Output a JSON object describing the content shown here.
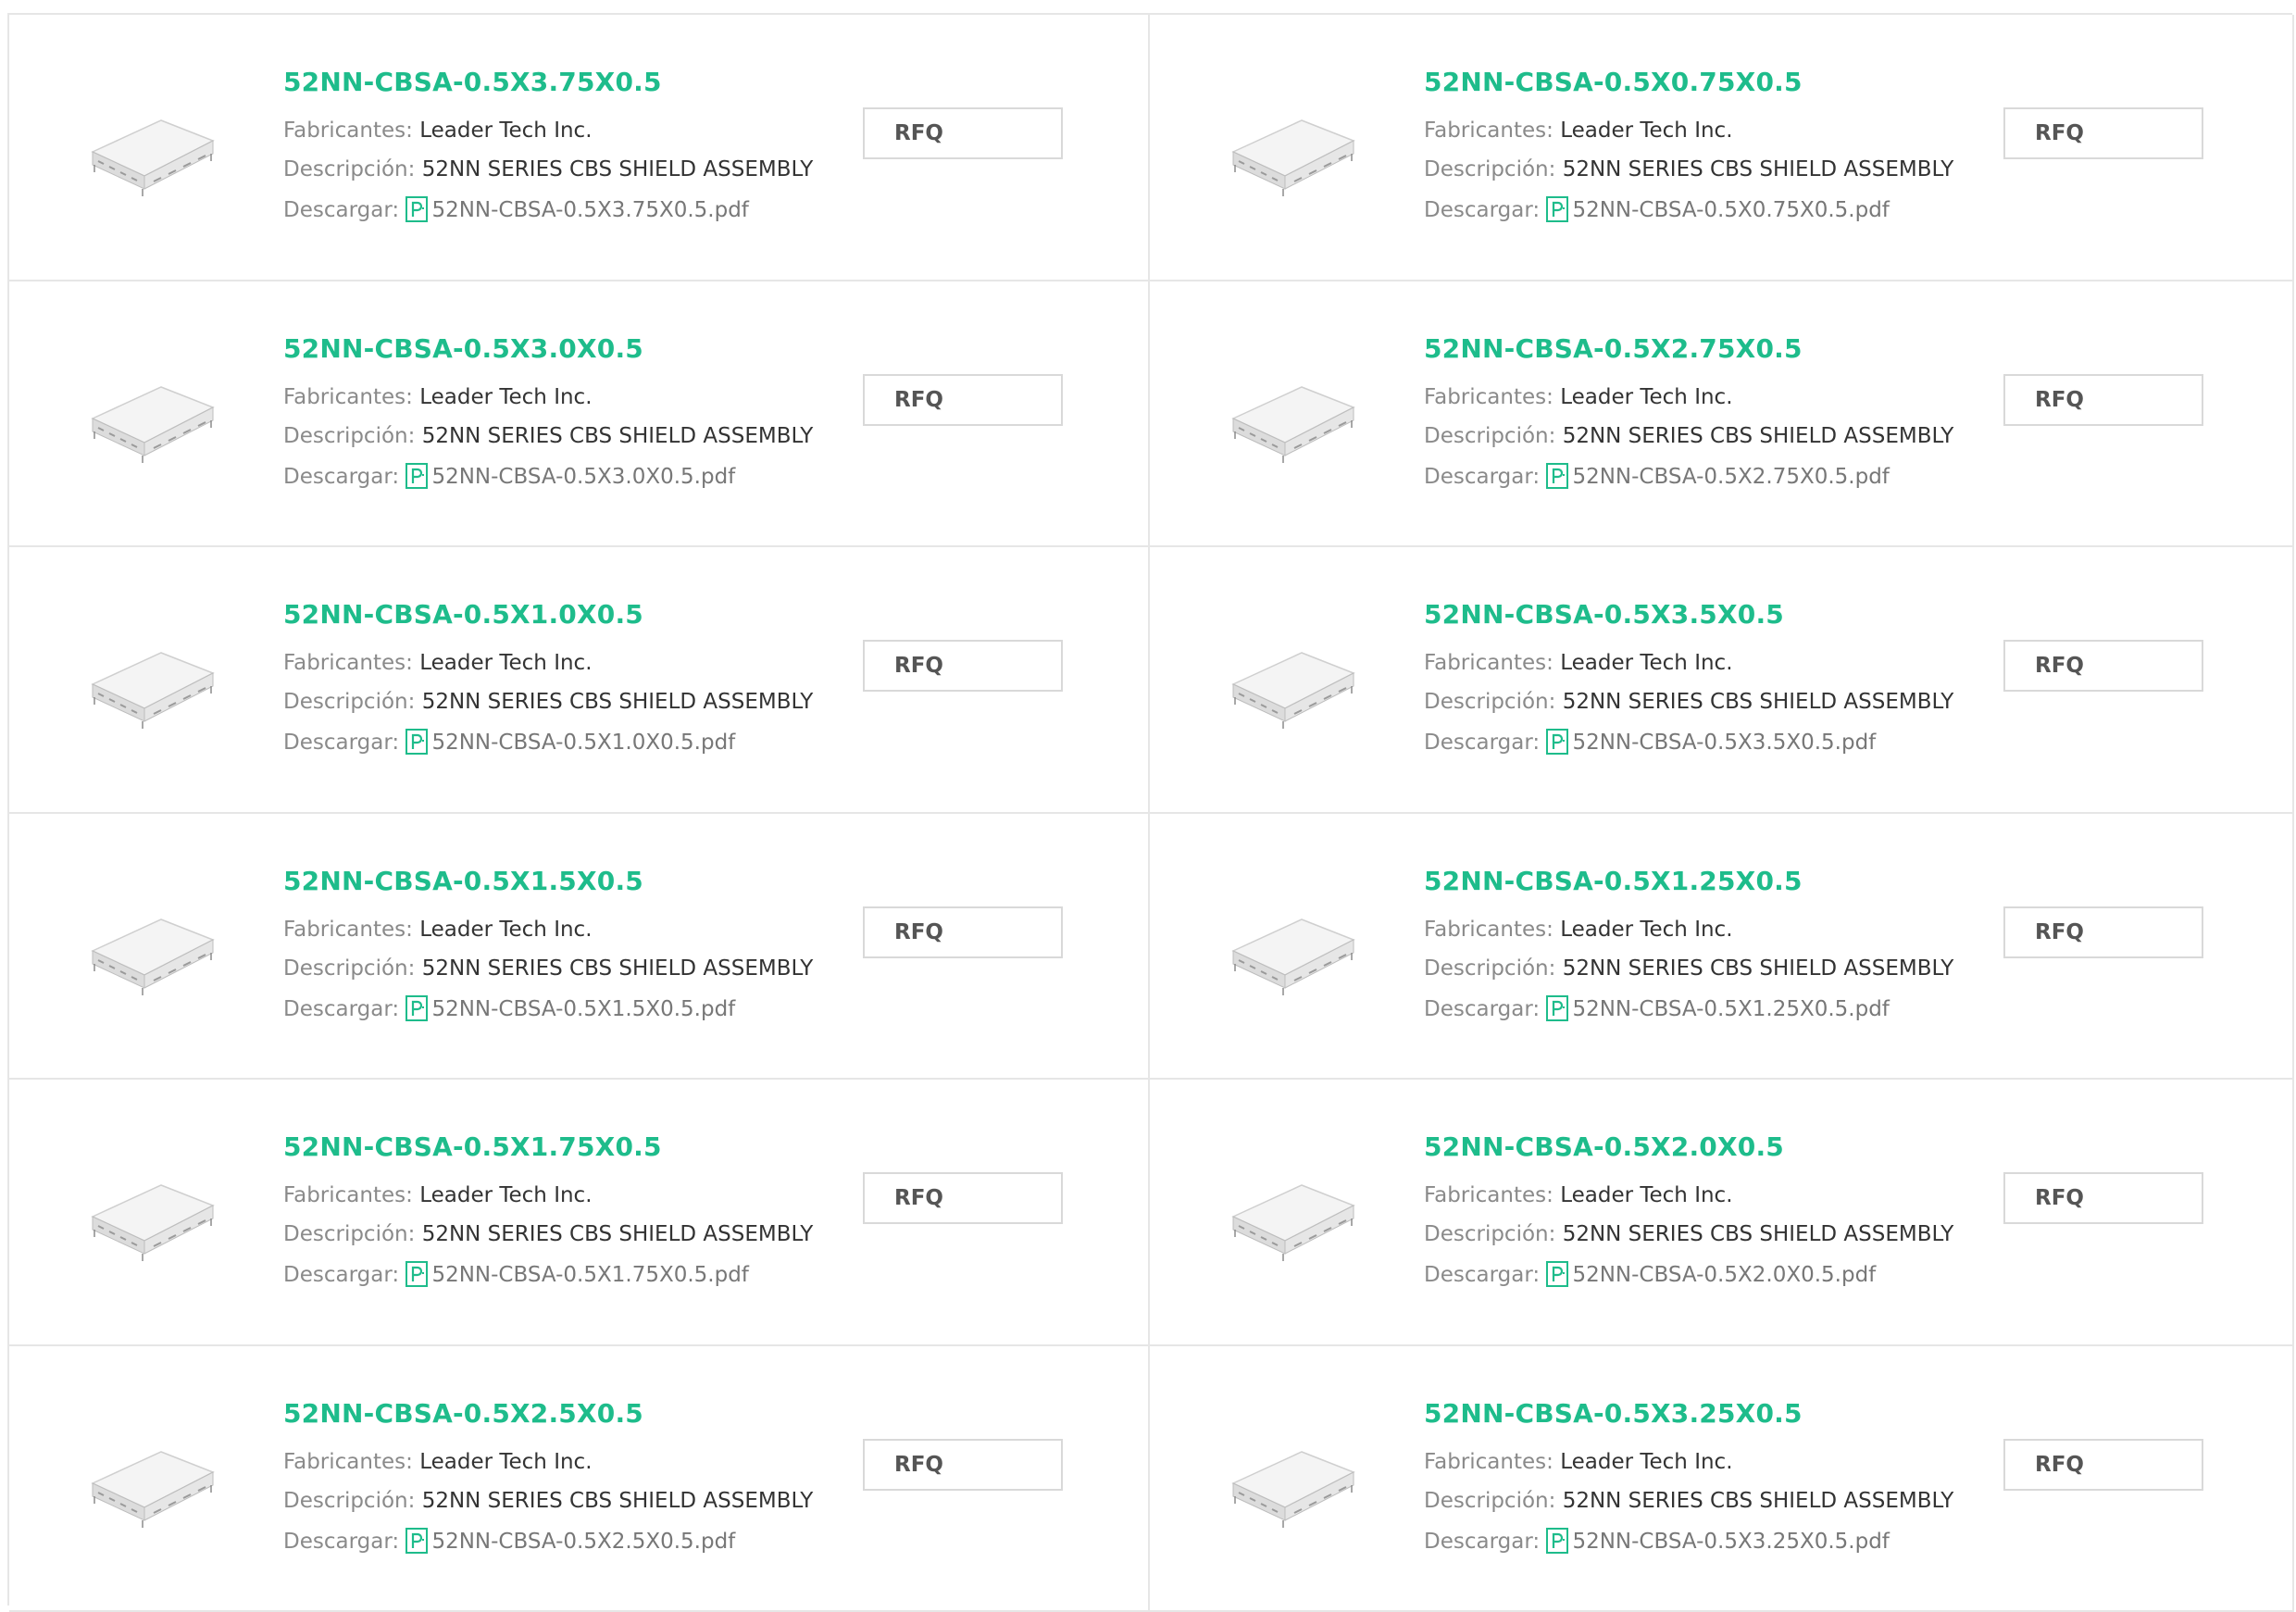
{
  "labels": {
    "manufacturer": "Fabricantes:",
    "description": "Descripción:",
    "download": "Descargar:",
    "rfq": "RFQ"
  },
  "colors": {
    "accent": "#1ebc8b",
    "border": "#e6e6e6"
  },
  "icons": {
    "pdf": "pdf-file-icon",
    "product": "product-thumbnail"
  },
  "products": [
    {
      "part": "52NN-CBSA-0.5X3.75X0.5",
      "manufacturer": "Leader Tech Inc.",
      "description": "52NN SERIES CBS SHIELD ASSEMBLY",
      "pdf": "52NN-CBSA-0.5X3.75X0.5.pdf"
    },
    {
      "part": "52NN-CBSA-0.5X0.75X0.5",
      "manufacturer": "Leader Tech Inc.",
      "description": "52NN SERIES CBS SHIELD ASSEMBLY",
      "pdf": "52NN-CBSA-0.5X0.75X0.5.pdf"
    },
    {
      "part": "52NN-CBSA-0.5X3.0X0.5",
      "manufacturer": "Leader Tech Inc.",
      "description": "52NN SERIES CBS SHIELD ASSEMBLY",
      "pdf": "52NN-CBSA-0.5X3.0X0.5.pdf"
    },
    {
      "part": "52NN-CBSA-0.5X2.75X0.5",
      "manufacturer": "Leader Tech Inc.",
      "description": "52NN SERIES CBS SHIELD ASSEMBLY",
      "pdf": "52NN-CBSA-0.5X2.75X0.5.pdf"
    },
    {
      "part": "52NN-CBSA-0.5X1.0X0.5",
      "manufacturer": "Leader Tech Inc.",
      "description": "52NN SERIES CBS SHIELD ASSEMBLY",
      "pdf": "52NN-CBSA-0.5X1.0X0.5.pdf"
    },
    {
      "part": "52NN-CBSA-0.5X3.5X0.5",
      "manufacturer": "Leader Tech Inc.",
      "description": "52NN SERIES CBS SHIELD ASSEMBLY",
      "pdf": "52NN-CBSA-0.5X3.5X0.5.pdf"
    },
    {
      "part": "52NN-CBSA-0.5X1.5X0.5",
      "manufacturer": "Leader Tech Inc.",
      "description": "52NN SERIES CBS SHIELD ASSEMBLY",
      "pdf": "52NN-CBSA-0.5X1.5X0.5.pdf"
    },
    {
      "part": "52NN-CBSA-0.5X1.25X0.5",
      "manufacturer": "Leader Tech Inc.",
      "description": "52NN SERIES CBS SHIELD ASSEMBLY",
      "pdf": "52NN-CBSA-0.5X1.25X0.5.pdf"
    },
    {
      "part": "52NN-CBSA-0.5X1.75X0.5",
      "manufacturer": "Leader Tech Inc.",
      "description": "52NN SERIES CBS SHIELD ASSEMBLY",
      "pdf": "52NN-CBSA-0.5X1.75X0.5.pdf"
    },
    {
      "part": "52NN-CBSA-0.5X2.0X0.5",
      "manufacturer": "Leader Tech Inc.",
      "description": "52NN SERIES CBS SHIELD ASSEMBLY",
      "pdf": "52NN-CBSA-0.5X2.0X0.5.pdf"
    },
    {
      "part": "52NN-CBSA-0.5X2.5X0.5",
      "manufacturer": "Leader Tech Inc.",
      "description": "52NN SERIES CBS SHIELD ASSEMBLY",
      "pdf": "52NN-CBSA-0.5X2.5X0.5.pdf"
    },
    {
      "part": "52NN-CBSA-0.5X3.25X0.5",
      "manufacturer": "Leader Tech Inc.",
      "description": "52NN SERIES CBS SHIELD ASSEMBLY",
      "pdf": "52NN-CBSA-0.5X3.25X0.5.pdf"
    }
  ]
}
